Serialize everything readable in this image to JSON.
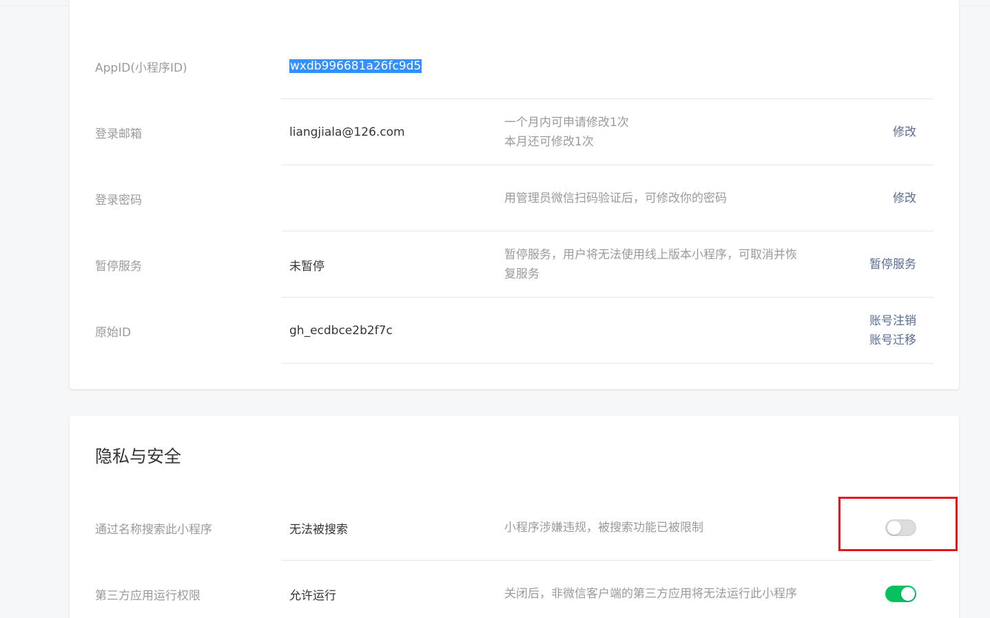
{
  "basic_info": {
    "rows": [
      {
        "label": "AppID(小程序ID)",
        "value": "wxdb996681a26fc9d5"
      },
      {
        "label": "登录邮箱",
        "value": "liangjiala@126.com",
        "desc": [
          "一个月内可申请修改1次",
          "本月还可修改1次"
        ],
        "actions": [
          "修改"
        ]
      },
      {
        "label": "登录密码",
        "value": "",
        "desc": [
          "用管理员微信扫码验证后，可修改你的密码"
        ],
        "actions": [
          "修改"
        ]
      },
      {
        "label": "暂停服务",
        "value": "未暂停",
        "desc": [
          "暂停服务，用户将无法使用线上版本小程序，可取消并恢",
          "复服务"
        ],
        "actions": [
          "暂停服务"
        ]
      },
      {
        "label": "原始ID",
        "value": "gh_ecdbce2b2f7c",
        "actions": [
          "账号注销",
          "账号迁移"
        ]
      }
    ]
  },
  "privacy": {
    "title": "隐私与安全",
    "rows": [
      {
        "label": "通过名称搜索此小程序",
        "value": "无法被搜索",
        "desc": "小程序涉嫌违规，被搜索功能已被限制",
        "toggle_on": false
      },
      {
        "label": "第三方应用运行权限",
        "value": "允许运行",
        "desc": "关闭后，非微信客户端的第三方应用将无法运行此小程序",
        "toggle_on": true
      }
    ]
  },
  "colors": {
    "link": "#576b95",
    "toggle_on": "#07c160",
    "highlight": "#e8131a",
    "selection": "#3390ff"
  }
}
